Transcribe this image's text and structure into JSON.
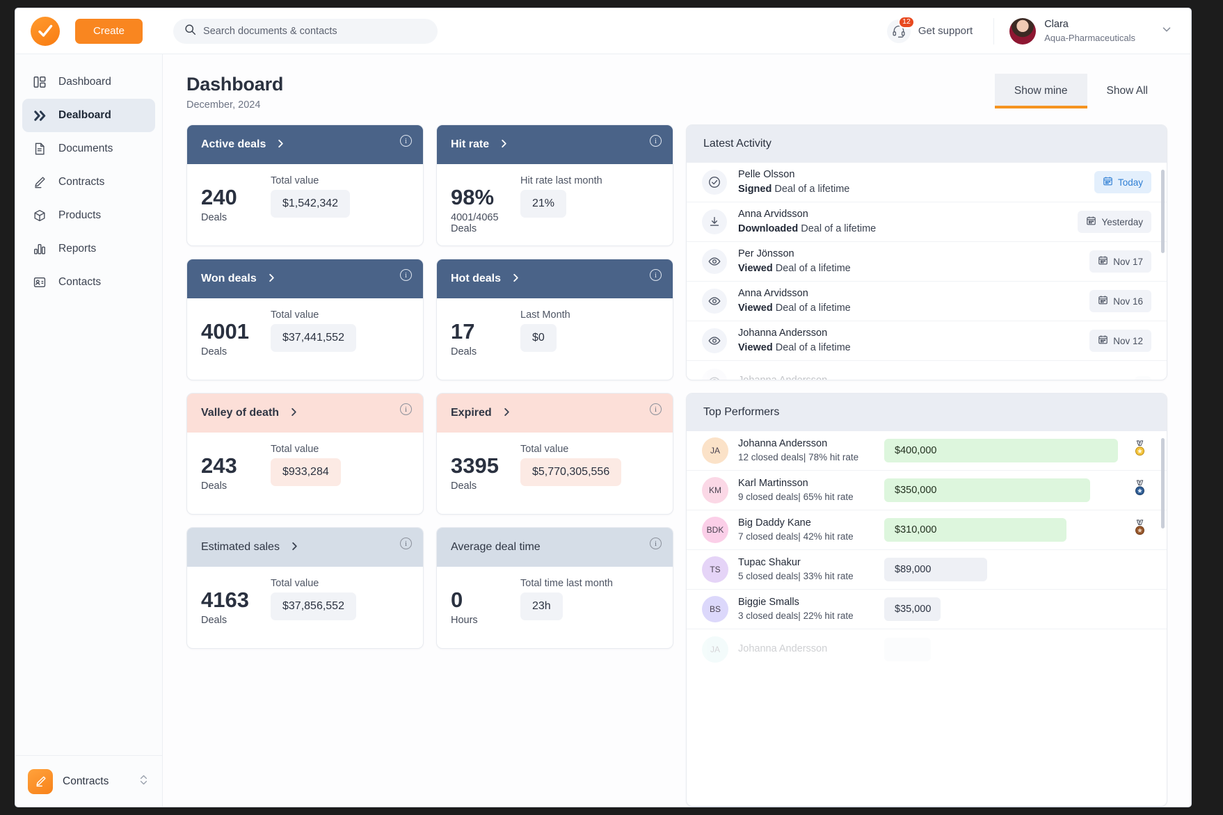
{
  "topbar": {
    "logo_name": "check-logo",
    "create_label": "Create",
    "search_placeholder": "Search documents & contacts",
    "search_value": "",
    "support_label": "Get support",
    "support_badge": "12",
    "profile_name": "Clara",
    "profile_org": "Aqua-Pharmaceuticals"
  },
  "sidebar": {
    "items": [
      {
        "label": "Dashboard",
        "icon": "layout-icon",
        "active": false
      },
      {
        "label": "Dealboard",
        "icon": "chevrons-right-icon",
        "active": true
      },
      {
        "label": "Documents",
        "icon": "document-icon",
        "active": false
      },
      {
        "label": "Contracts",
        "icon": "pen-icon",
        "active": false
      },
      {
        "label": "Products",
        "icon": "cube-icon",
        "active": false
      },
      {
        "label": "Reports",
        "icon": "bar-chart-icon",
        "active": false
      },
      {
        "label": "Contacts",
        "icon": "contact-card-icon",
        "active": false
      }
    ],
    "footer_label": "Contracts"
  },
  "page": {
    "title": "Dashboard",
    "subtitle": "December, 2024",
    "tabs": [
      {
        "label": "Show mine",
        "active": true
      },
      {
        "label": "Show All",
        "active": false
      }
    ]
  },
  "cards": [
    {
      "title": "Active deals",
      "theme": "blue",
      "has_chevron": true,
      "number": "240",
      "number_sub": "Deals",
      "value_label": "Total value",
      "value": "$1,542,342",
      "pill_theme": "grey"
    },
    {
      "title": "Hit rate",
      "theme": "blue",
      "has_chevron": true,
      "number": "98%",
      "number_sub": "4001/4065 Deals",
      "value_label": "Hit rate last month",
      "value": "21%",
      "pill_theme": "grey"
    },
    {
      "title": "Won deals",
      "theme": "blue",
      "has_chevron": true,
      "number": "4001",
      "number_sub": "Deals",
      "value_label": "Total value",
      "value": "$37,441,552",
      "pill_theme": "grey"
    },
    {
      "title": "Hot deals",
      "theme": "blue",
      "has_chevron": true,
      "number": "17",
      "number_sub": "Deals",
      "value_label": "Last Month",
      "value": "$0",
      "pill_theme": "grey"
    },
    {
      "title": "Valley of death",
      "theme": "rose",
      "has_chevron": true,
      "number": "243",
      "number_sub": "Deals",
      "value_label": "Total value",
      "value": "$933,284",
      "pill_theme": "rose"
    },
    {
      "title": "Expired",
      "theme": "rose",
      "has_chevron": true,
      "number": "3395",
      "number_sub": "Deals",
      "value_label": "Total value",
      "value": "$5,770,305,556",
      "pill_theme": "rose"
    },
    {
      "title": "Estimated sales",
      "theme": "steel",
      "has_chevron": true,
      "number": "4163",
      "number_sub": "Deals",
      "value_label": "Total value",
      "value": "$37,856,552",
      "pill_theme": "grey"
    },
    {
      "title": "Average deal time",
      "theme": "steel",
      "has_chevron": false,
      "number": "0",
      "number_sub": "Hours",
      "value_label": "Total time last month",
      "value": "23h",
      "pill_theme": "grey"
    }
  ],
  "activity": {
    "title": "Latest Activity",
    "rows": [
      {
        "name": "Pelle Olsson",
        "action": "Signed",
        "object": "Deal of a lifetime",
        "date": "Today",
        "icon": "check-circle-icon",
        "highlight": true,
        "fade": false
      },
      {
        "name": "Anna Arvidsson",
        "action": "Downloaded",
        "object": "Deal of a lifetime",
        "date": "Yesterday",
        "icon": "download-icon",
        "highlight": false,
        "fade": false
      },
      {
        "name": "Per Jönsson",
        "action": "Viewed",
        "object": "Deal of a lifetime",
        "date": "Nov 17",
        "icon": "eye-icon",
        "highlight": false,
        "fade": false
      },
      {
        "name": "Anna Arvidsson",
        "action": "Viewed",
        "object": "Deal of a lifetime",
        "date": "Nov 16",
        "icon": "eye-icon",
        "highlight": false,
        "fade": false
      },
      {
        "name": "Johanna Andersson",
        "action": "Viewed",
        "object": "Deal of a lifetime",
        "date": "Nov 12",
        "icon": "eye-icon",
        "highlight": false,
        "fade": false
      },
      {
        "name": "Johanna Andersson",
        "action": "",
        "object": "",
        "date": "",
        "icon": "eye-icon",
        "highlight": false,
        "fade": true
      }
    ]
  },
  "performers": {
    "title": "Top Performers",
    "rows": [
      {
        "initials": "JA",
        "avatar_color": "#fbe2c8",
        "name": "Johanna Andersson",
        "meta": "12 closed deals| 78% hit rate",
        "amount": "$400,000",
        "bar_pct": 100,
        "bar_theme": "green",
        "medal": "gold-medal-icon",
        "fade": false
      },
      {
        "initials": "KM",
        "avatar_color": "#fbd8e6",
        "name": "Karl Martinsson",
        "meta": "9 closed deals| 65% hit rate",
        "amount": "$350,000",
        "bar_pct": 88,
        "bar_theme": "green",
        "medal": "silver-medal-icon",
        "fade": false
      },
      {
        "initials": "BDK",
        "avatar_color": "#fbcfe8",
        "name": "Big Daddy Kane",
        "meta": "7 closed deals| 42% hit rate",
        "amount": "$310,000",
        "bar_pct": 78,
        "bar_theme": "green",
        "medal": "bronze-medal-icon",
        "fade": false
      },
      {
        "initials": "TS",
        "avatar_color": "#e5d4f7",
        "name": "Tupac Shakur",
        "meta": "5 closed deals| 33% hit rate",
        "amount": "$89,000",
        "bar_pct": 44,
        "bar_theme": "grey",
        "medal": "",
        "fade": false
      },
      {
        "initials": "BS",
        "avatar_color": "#dcd8fb",
        "name": "Biggie Smalls",
        "meta": "3 closed deals| 22% hit rate",
        "amount": "$35,000",
        "bar_pct": 24,
        "bar_theme": "grey",
        "medal": "",
        "fade": false
      },
      {
        "initials": "JA",
        "avatar_color": "#ccf1ef",
        "name": "Johanna Andersson",
        "meta": "",
        "amount": "",
        "bar_pct": 20,
        "bar_theme": "grey",
        "medal": "",
        "fade": true
      }
    ]
  },
  "colors": {
    "brand_orange": "#f98620",
    "card_blue": "#4a6388",
    "card_rose": "#fcdfd8",
    "card_steel": "#d5dde7",
    "bar_green": "#ddf6dd",
    "accent_underline": "#f59420",
    "badge_red": "#e8491f",
    "today_blue": "#2f7fd4"
  }
}
